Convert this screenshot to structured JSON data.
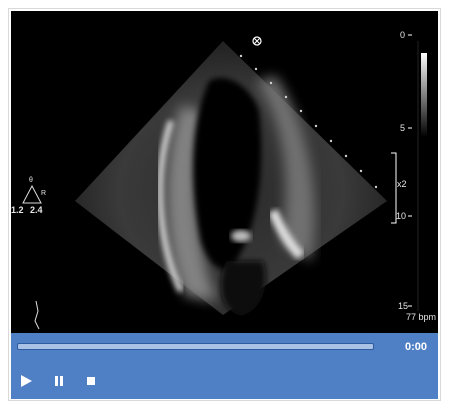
{
  "colors": {
    "control_bar": "#4f7fc4",
    "progress_track": "#a9c2e6",
    "video_bg": "#000000",
    "icon": "#ffffff"
  },
  "overlay": {
    "depth_scale": {
      "labels": [
        "0",
        "5",
        "10",
        "15"
      ]
    },
    "heart_rate": "77 bpm",
    "focus_marker": "x2",
    "probe": {
      "theta": "θ",
      "r": "R",
      "left": "1.2",
      "right": "2.4"
    }
  },
  "player": {
    "time": "0:00",
    "progress": 0,
    "controls": [
      {
        "name": "play-icon",
        "action": "play"
      },
      {
        "name": "pause-icon",
        "action": "pause"
      },
      {
        "name": "stop-icon",
        "action": "stop"
      }
    ]
  }
}
